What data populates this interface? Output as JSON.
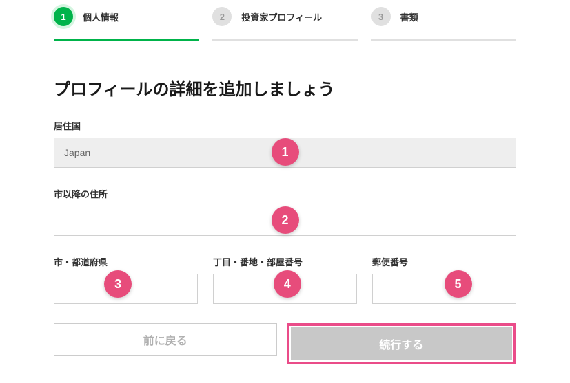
{
  "stepper": {
    "steps": [
      {
        "num": "1",
        "label": "個人情報",
        "active": true
      },
      {
        "num": "2",
        "label": "投資家プロフィール",
        "active": false
      },
      {
        "num": "3",
        "label": "書類",
        "active": false
      }
    ]
  },
  "form": {
    "title": "プロフィールの詳細を追加しましょう",
    "country_label": "居住国",
    "country_value": "Japan",
    "address_label": "市以降の住所",
    "address_value": "",
    "city_label": "市・都道府県",
    "city_value": "",
    "block_label": "丁目・番地・部屋番号",
    "block_value": "",
    "postal_label": "郵便番号",
    "postal_value": ""
  },
  "buttons": {
    "back": "前に戻る",
    "continue": "続行する"
  },
  "badges": {
    "b1": "1",
    "b2": "2",
    "b3": "3",
    "b4": "4",
    "b5": "5"
  }
}
